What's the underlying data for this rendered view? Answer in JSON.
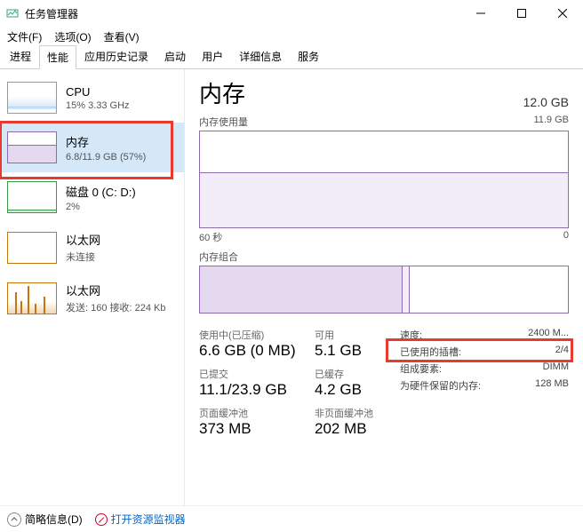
{
  "window": {
    "title": "任务管理器"
  },
  "menu": {
    "file": "文件(F)",
    "options": "选项(O)",
    "view": "查看(V)"
  },
  "tabs": [
    "进程",
    "性能",
    "应用历史记录",
    "启动",
    "用户",
    "详细信息",
    "服务"
  ],
  "sidebar": {
    "items": [
      {
        "label": "CPU",
        "sub": "15% 3.33 GHz"
      },
      {
        "label": "内存",
        "sub": "6.8/11.9 GB (57%)"
      },
      {
        "label": "磁盘 0 (C: D:)",
        "sub": "2%"
      },
      {
        "label": "以太网",
        "sub": "未连接"
      },
      {
        "label": "以太网",
        "sub": "发送: 160 接收: 224 Kb"
      }
    ]
  },
  "main": {
    "title": "内存",
    "total": "12.0 GB",
    "usage_label": "内存使用量",
    "usage_max": "11.9 GB",
    "axis_time": "60 秒",
    "axis_zero": "0",
    "comp_label": "内存组合",
    "stats": {
      "in_use_label": "使用中(已压缩)",
      "in_use_value": "6.6 GB (0 MB)",
      "available_label": "可用",
      "available_value": "5.1 GB",
      "committed_label": "已提交",
      "committed_value": "11.1/23.9 GB",
      "cached_label": "已缓存",
      "cached_value": "4.2 GB",
      "paged_label": "页面缓冲池",
      "paged_value": "373 MB",
      "nonpaged_label": "非页面缓冲池",
      "nonpaged_value": "202 MB"
    },
    "info": {
      "speed_label": "速度:",
      "speed_value": "2400 M...",
      "slots_label": "已使用的插槽:",
      "slots_value": "2/4",
      "form_label": "组成要素:",
      "form_value": "DIMM",
      "reserved_label": "为硬件保留的内存:",
      "reserved_value": "128 MB"
    }
  },
  "footer": {
    "fewer": "简略信息(D)",
    "resmon": "打开资源监视器"
  },
  "chart_data": {
    "type": "area",
    "title": "内存使用量",
    "ylabel": "GB",
    "ylim": [
      0,
      11.9
    ],
    "xlim_seconds": [
      60,
      0
    ],
    "series": [
      {
        "name": "使用中",
        "approx_constant_value": 6.8
      }
    ],
    "composition": {
      "total": 11.9,
      "in_use": 6.6,
      "modified": 0.2,
      "standby": 5.1,
      "free": 0.0
    }
  }
}
